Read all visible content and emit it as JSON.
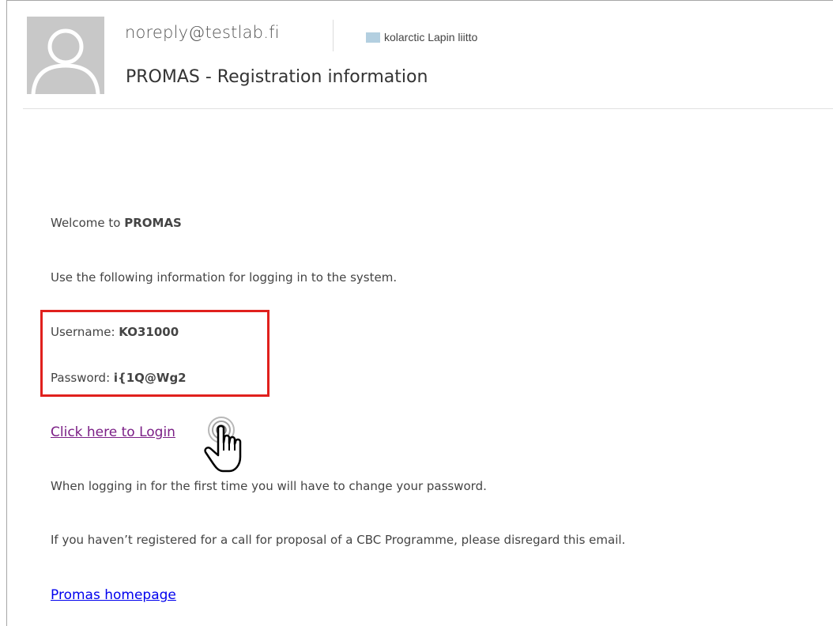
{
  "email": {
    "sender": "noreply@testlab.fi",
    "category": "kolarctic Lapin liitto",
    "subject": "PROMAS - Registration information"
  },
  "body": {
    "welcome_prefix": "Welcome to ",
    "welcome_brand": "PROMAS",
    "instructions": "Use the following information for logging in to the system.",
    "username_label": "Username: ",
    "username_value": "KO31000",
    "password_label": "Password: ",
    "password_value": "i{1Q@Wg2",
    "login_link": "Click here to Login",
    "first_login_note": "When logging in for the first time you will have to change your password.",
    "disregard_note": "If you haven’t registered for a call for proposal of a CBC Programme, please disregard this email.",
    "homepage_link": "Promas homepage"
  },
  "colors": {
    "highlight": "#e0201d",
    "visited_link": "#7b1f86",
    "link": "#0000ee",
    "category_swatch": "#b3cfe0"
  },
  "icons": {
    "avatar": "person-silhouette-icon",
    "cursor": "hand-pointer-cursor-icon"
  }
}
